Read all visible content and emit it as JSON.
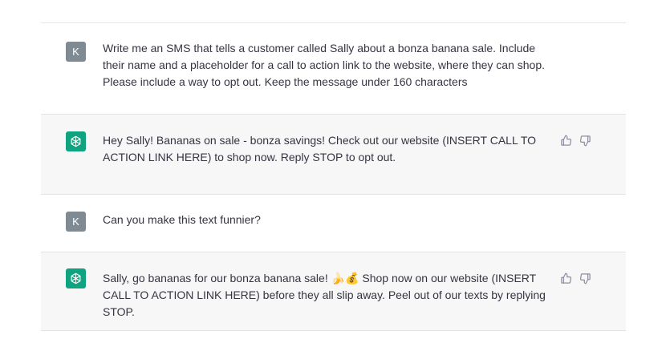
{
  "conversation": {
    "messages": [
      {
        "role": "user",
        "avatar_letter": "K",
        "text": "Write me an SMS that tells a customer called Sally about a bonza banana sale. Include their name and a placeholder for a call to action link to the website, where they can shop. Please include a way to opt out. Keep the message under 160 characters"
      },
      {
        "role": "assistant",
        "avatar_icon": "chatgpt-logo-icon",
        "text": "Hey Sally! Bananas on sale - bonza savings! Check out our website (INSERT CALL TO ACTION LINK HERE) to shop now. Reply STOP to opt out.",
        "actions": [
          "thumbs-up-icon",
          "thumbs-down-icon"
        ]
      },
      {
        "role": "user",
        "avatar_letter": "K",
        "text": "Can you make this text funnier?"
      },
      {
        "role": "assistant",
        "avatar_icon": "chatgpt-logo-icon",
        "text": "Sally, go bananas for our bonza banana sale! 🍌💰 Shop now on our website (INSERT CALL TO ACTION LINK HERE) before they all slip away. Peel out of our texts by replying STOP.",
        "actions": [
          "thumbs-up-icon",
          "thumbs-down-icon"
        ]
      }
    ]
  },
  "colors": {
    "user_avatar": "#7f8a93",
    "assistant_avatar": "#10a37f",
    "assistant_row_bg": "#f7f7f8"
  }
}
